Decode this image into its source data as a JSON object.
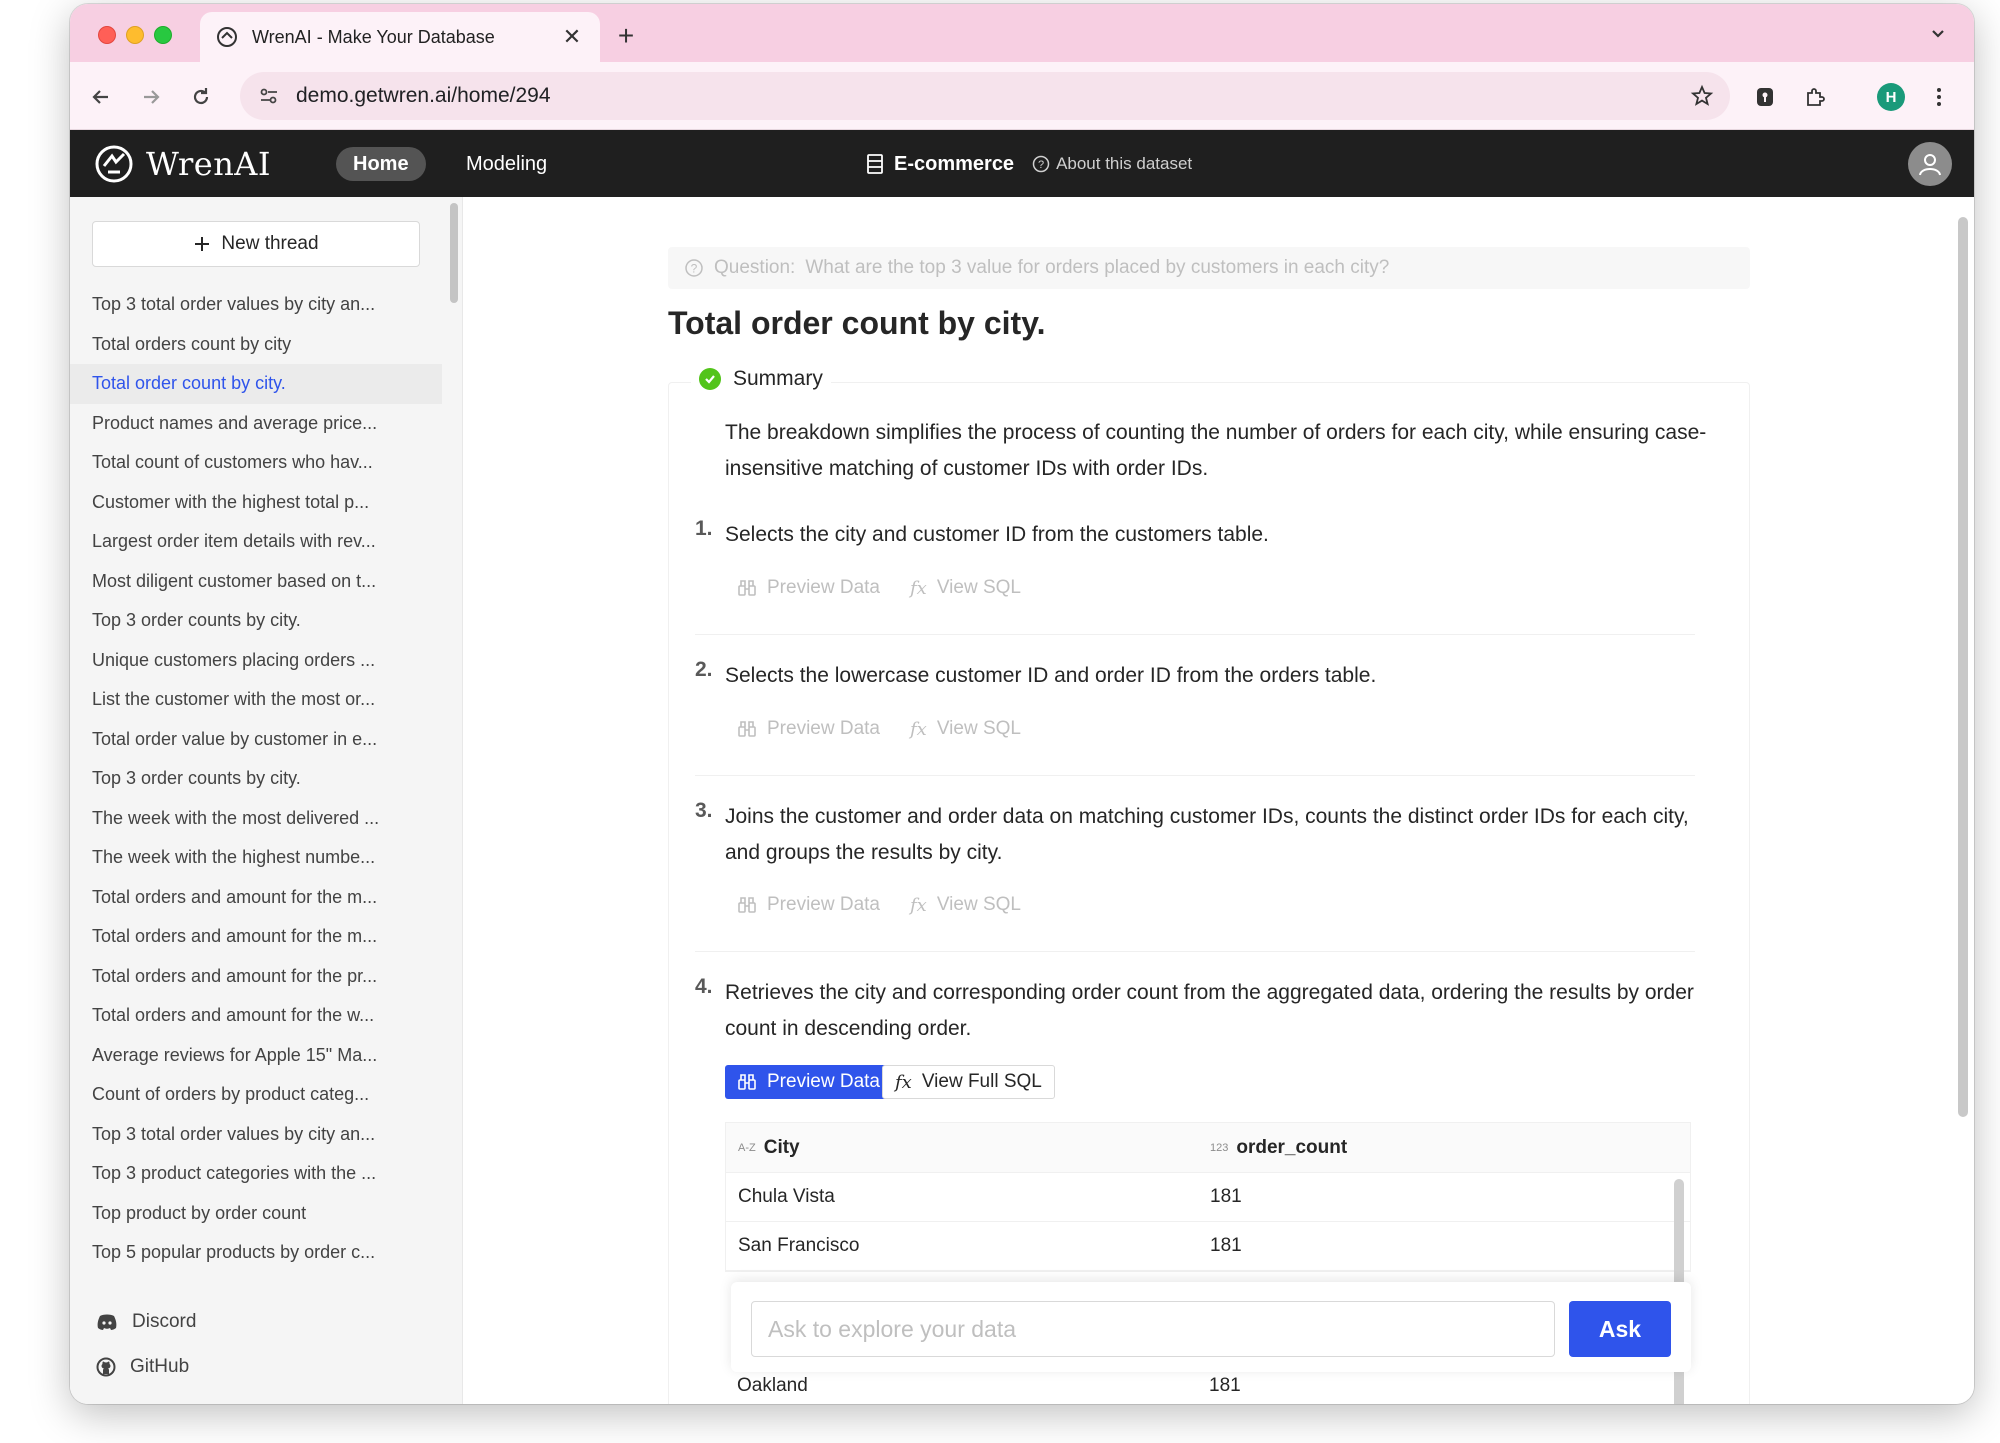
{
  "browser": {
    "tab_title": "WrenAI - Make Your Database",
    "url": "demo.getwren.ai/home/294",
    "profile_initial": "H"
  },
  "app": {
    "logo_text": "WrenAI",
    "nav": {
      "home": "Home",
      "modeling": "Modeling"
    },
    "dataset_name": "E-commerce",
    "about_dataset": "About this dataset"
  },
  "sidebar": {
    "new_thread": "New thread",
    "threads": [
      "Top 3 total order values by city an...",
      "Total orders count by city",
      "Total order count by city.",
      "Product names and average price...",
      "Total count of customers who hav...",
      "Customer with the highest total p...",
      "Largest order item details with rev...",
      "Most diligent customer based on t...",
      "Top 3 order counts by city.",
      "Unique customers placing orders ...",
      "List the customer with the most or...",
      "Total order value by customer in e...",
      "Top 3 order counts by city.",
      "The week with the most delivered ...",
      "The week with the highest numbe...",
      "Total orders and amount for the m...",
      "Total orders and amount for the m...",
      "Total orders and amount for the pr...",
      "Total orders and amount for the w...",
      "Average reviews for Apple 15\" Ma...",
      "Count of orders by product categ...",
      "Top 3 total order values by city an...",
      "Top 3 product categories with the ...",
      "Top product by order count",
      "Top 5 popular products by order c..."
    ],
    "active_index": 2,
    "footer": {
      "discord": "Discord",
      "github": "GitHub"
    }
  },
  "main": {
    "question_label": "Question:",
    "question_text": "What are the top 3 value for orders placed by customers in each city?",
    "answer_title": "Total order count by city.",
    "summary_label": "Summary",
    "summary_text": "The breakdown simplifies the process of counting the number of orders for each city, while ensuring case-insensitive matching of customer IDs with order IDs.",
    "steps": [
      {
        "num": "1.",
        "text": "Selects the city and customer ID from the customers table."
      },
      {
        "num": "2.",
        "text": "Selects the lowercase customer ID and order ID from the orders table."
      },
      {
        "num": "3.",
        "text": "Joins the customer and order data on matching customer IDs, counts the distinct order IDs for each city, and groups the results by city."
      },
      {
        "num": "4.",
        "text": "Retrieves the city and corresponding order count from the aggregated data, ordering the results by order count in descending order."
      }
    ],
    "preview_data": "Preview Data",
    "view_sql": "View SQL",
    "view_full_sql": "View Full SQL",
    "table": {
      "columns": [
        {
          "type_tag": "A-Z",
          "name": "City"
        },
        {
          "type_tag": "123",
          "name": "order_count"
        }
      ],
      "rows": [
        [
          "Chula Vista",
          "181"
        ],
        [
          "San Francisco",
          "181"
        ]
      ],
      "last_row": [
        "Oakland",
        "181"
      ]
    },
    "ask": {
      "placeholder": "Ask to explore your data",
      "button": "Ask"
    }
  }
}
